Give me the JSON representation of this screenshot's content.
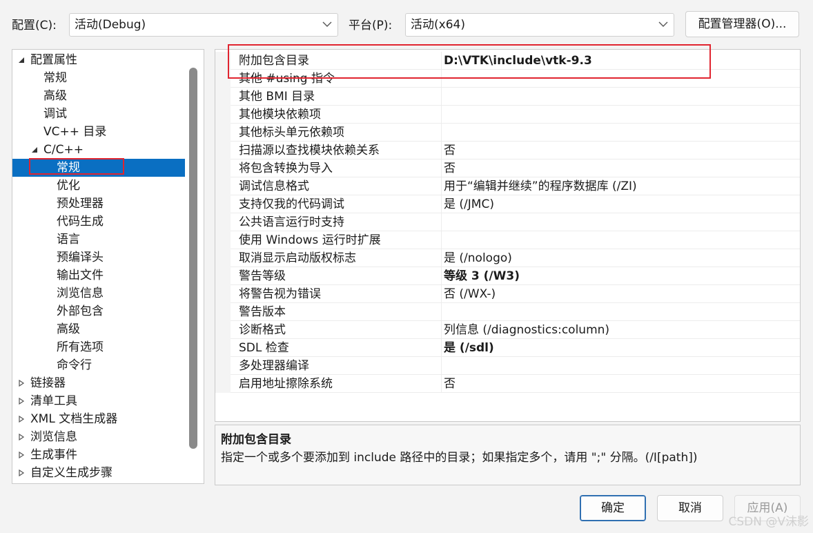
{
  "config_bar": {
    "config_label": "配置(C):",
    "config_value": "活动(Debug)",
    "platform_label": "平台(P):",
    "platform_value": "活动(x64)",
    "manager_button": "配置管理器(O)..."
  },
  "tree": {
    "items": [
      {
        "label": "配置属性",
        "level": 0,
        "state": "expanded"
      },
      {
        "label": "常规",
        "level": 1
      },
      {
        "label": "高级",
        "level": 1
      },
      {
        "label": "调试",
        "level": 1
      },
      {
        "label": "VC++ 目录",
        "level": 1
      },
      {
        "label": "C/C++",
        "level": 1,
        "state": "expanded"
      },
      {
        "label": "常规",
        "level": 2,
        "selected": true
      },
      {
        "label": "优化",
        "level": 2
      },
      {
        "label": "预处理器",
        "level": 2
      },
      {
        "label": "代码生成",
        "level": 2
      },
      {
        "label": "语言",
        "level": 2
      },
      {
        "label": "预编译头",
        "level": 2
      },
      {
        "label": "输出文件",
        "level": 2
      },
      {
        "label": "浏览信息",
        "level": 2
      },
      {
        "label": "外部包含",
        "level": 2
      },
      {
        "label": "高级",
        "level": 2
      },
      {
        "label": "所有选项",
        "level": 2
      },
      {
        "label": "命令行",
        "level": 2
      },
      {
        "label": "链接器",
        "level": 0,
        "state": "collapsed"
      },
      {
        "label": "清单工具",
        "level": 0,
        "state": "collapsed"
      },
      {
        "label": "XML 文档生成器",
        "level": 0,
        "state": "collapsed"
      },
      {
        "label": "浏览信息",
        "level": 0,
        "state": "collapsed"
      },
      {
        "label": "生成事件",
        "level": 0,
        "state": "collapsed"
      },
      {
        "label": "自定义生成步骤",
        "level": 0,
        "state": "collapsed"
      }
    ]
  },
  "properties": [
    {
      "name": "附加包含目录",
      "value": "D:\\VTK\\include\\vtk-9.3",
      "bold": true
    },
    {
      "name": "其他 #using 指令",
      "value": ""
    },
    {
      "name": "其他 BMI 目录",
      "value": ""
    },
    {
      "name": "其他模块依赖项",
      "value": ""
    },
    {
      "name": "其他标头单元依赖项",
      "value": ""
    },
    {
      "name": "扫描源以查找模块依赖关系",
      "value": "否"
    },
    {
      "name": "将包含转换为导入",
      "value": "否"
    },
    {
      "name": "调试信息格式",
      "value": "用于“编辑并继续”的程序数据库 (/ZI)"
    },
    {
      "name": "支持仅我的代码调试",
      "value": "是 (/JMC)"
    },
    {
      "name": "公共语言运行时支持",
      "value": ""
    },
    {
      "name": "使用 Windows 运行时扩展",
      "value": ""
    },
    {
      "name": "取消显示启动版权标志",
      "value": "是 (/nologo)"
    },
    {
      "name": "警告等级",
      "value": "等级 3 (/W3)",
      "bold": true
    },
    {
      "name": "将警告视为错误",
      "value": "否 (/WX-)"
    },
    {
      "name": "警告版本",
      "value": ""
    },
    {
      "name": "诊断格式",
      "value": "列信息 (/diagnostics:column)"
    },
    {
      "name": "SDL 检查",
      "value": "是 (/sdl)",
      "bold": true
    },
    {
      "name": "多处理器编译",
      "value": ""
    },
    {
      "name": "启用地址擦除系统",
      "value": "否"
    }
  ],
  "description": {
    "title": "附加包含目录",
    "text": "指定一个或多个要添加到 include 路径中的目录；如果指定多个，请用 \";\" 分隔。(/I[path])"
  },
  "buttons": {
    "ok": "确定",
    "cancel": "取消",
    "apply": "应用(A)"
  },
  "watermark": "CSDN @V沫影",
  "colors": {
    "selection": "#0a6fc2",
    "highlight_box": "#e0242f",
    "primary_border": "#2f6fb1"
  }
}
